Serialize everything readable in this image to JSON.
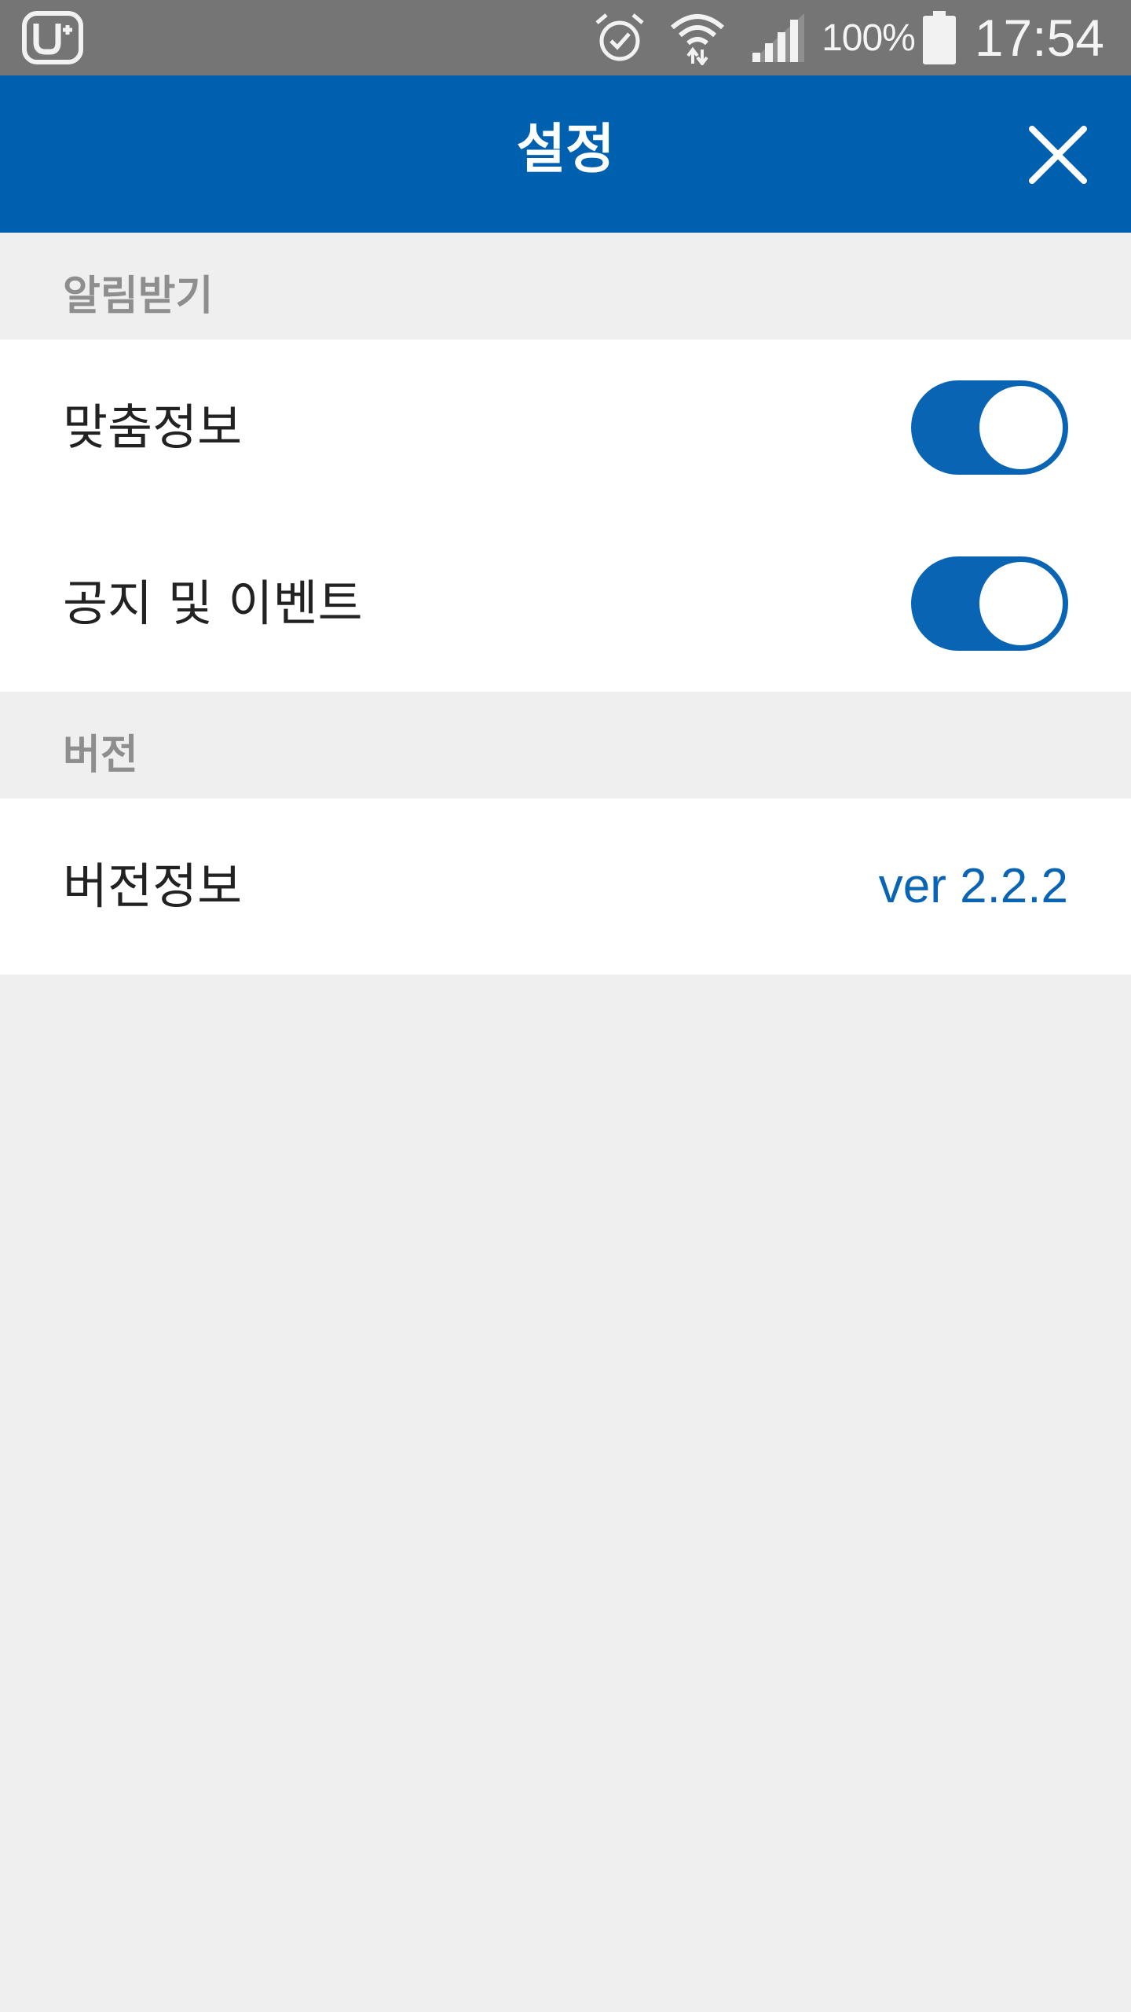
{
  "status_bar": {
    "carrier_icon": "lg-uplus-icon",
    "alarm_icon": "alarm-clock-icon",
    "wifi_icon": "wifi-icon",
    "signal_icon": "cell-signal-icon",
    "battery_percent": "100%",
    "battery_icon": "battery-full-icon",
    "time": "17:54"
  },
  "app_bar": {
    "title": "설정",
    "close_icon": "close-icon",
    "color": "#0060b0"
  },
  "sections": {
    "notifications": {
      "header": "알림받기",
      "items": [
        {
          "label": "맞춤정보",
          "enabled": true
        },
        {
          "label": "공지 및 이벤트",
          "enabled": true
        }
      ]
    },
    "version": {
      "header": "버전",
      "items": [
        {
          "label": "버전정보",
          "value": "ver 2.2.2"
        }
      ]
    }
  },
  "colors": {
    "accent": "#0a64b4",
    "status_bar_bg": "#757575",
    "page_bg": "#efefef",
    "section_header_text": "#8e8e8e"
  }
}
